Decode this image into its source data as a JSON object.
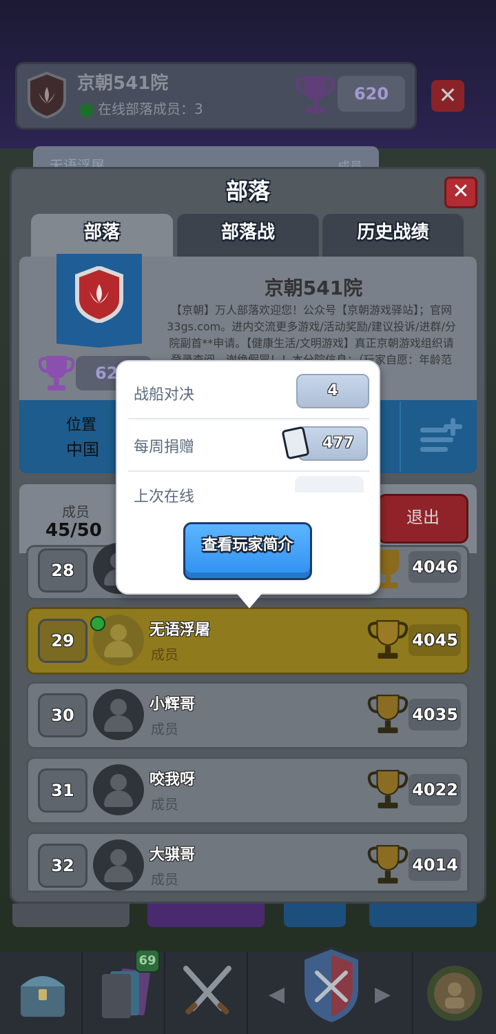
{
  "background": {
    "top_card": {
      "clan_name": "京朝541院",
      "online_label": "在线部落成员：",
      "online_count": "3",
      "score": "620"
    },
    "peek_card": {
      "name": "无语浮屠",
      "role": "成员"
    }
  },
  "panel": {
    "title": "部落",
    "tabs": [
      {
        "label": "部落"
      },
      {
        "label": "部落战"
      },
      {
        "label": "历史战绩"
      }
    ],
    "clan": {
      "name": "京朝541院",
      "trophy_score": "62",
      "description": "【京朝】万人部落欢迎您！公众号【京朝游戏驿站】；官网33gs.com。进内交流更多游戏/活动奖励/建议投诉/进群/分院副首**申请。【健康生活/文明游戏】真正京朝游戏组织请登录查阅，谢绝假冒！！本分院信息：（玩家自愿：年龄范围）"
    },
    "location": {
      "label": "位置",
      "value": "中国"
    },
    "members": {
      "label": "成员",
      "count": "45/50"
    },
    "leave_label": "退出",
    "rows": [
      {
        "rank": "28",
        "name": "",
        "role": "",
        "score": "4046"
      },
      {
        "rank": "29",
        "name": "无语浮屠",
        "role": "成员",
        "score": "4045",
        "online": true,
        "highlighted": true
      },
      {
        "rank": "30",
        "name": "小辉哥",
        "role": "成员",
        "score": "4035"
      },
      {
        "rank": "31",
        "name": "咬我呀",
        "role": "成员",
        "score": "4022"
      },
      {
        "rank": "32",
        "name": "大骐哥",
        "role": "成员",
        "score": "4014"
      }
    ]
  },
  "popup": {
    "battle_label": "战船对决",
    "battle_value": "4",
    "donate_label": "每周捐赠",
    "donate_value": "477",
    "last_online_label": "上次在线",
    "profile_button": "查看玩家简介"
  },
  "bottom_nav": {
    "cards_badge": "69"
  },
  "colors": {
    "accent_blue": "#2f8ff0",
    "highlight_gold": "#8f7a1e",
    "close_red": "#b32b33"
  }
}
